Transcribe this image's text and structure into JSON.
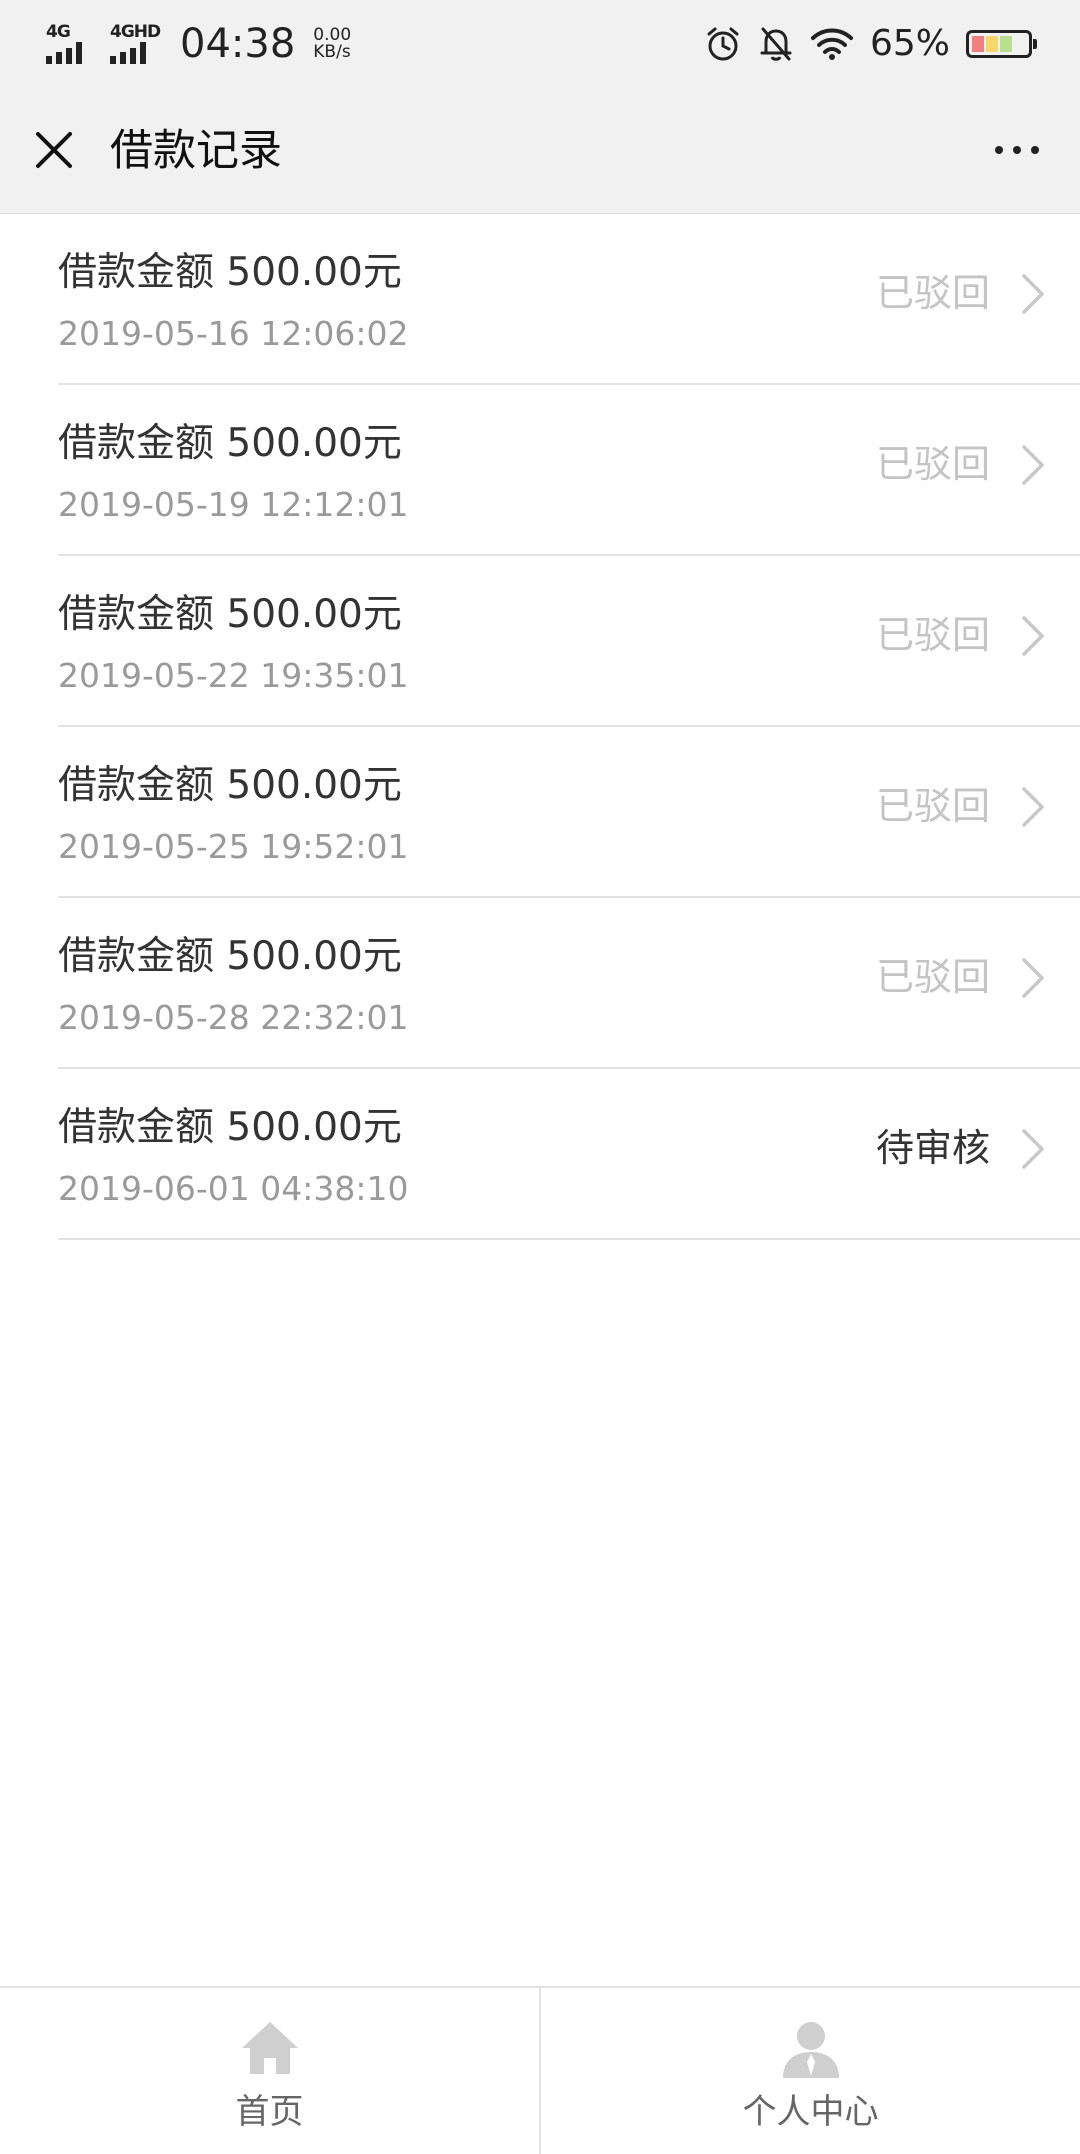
{
  "status_bar": {
    "network_1": "4G",
    "network_2": "4GHD",
    "time": "04:38",
    "speed_value": "0.00",
    "speed_unit": "KB/s",
    "battery_percent": "65%",
    "icons": [
      "alarm-icon",
      "bell-off-icon",
      "wifi-icon",
      "battery-icon"
    ]
  },
  "nav": {
    "title": "借款记录",
    "close_icon": "close-icon",
    "more_icon": "more-icon"
  },
  "colors": {
    "status_rejected": "#c4c4c4",
    "status_pending": "#333333",
    "date_gray": "#9a9a9a",
    "bar_bg": "#f1f1f1",
    "tab_icon_gray": "#cfcfcf"
  },
  "loans": [
    {
      "title": "借款金额 500.00元",
      "date": "2019-05-16 12:06:02",
      "status": "已驳回",
      "state": "rejected"
    },
    {
      "title": "借款金额 500.00元",
      "date": "2019-05-19 12:12:01",
      "status": "已驳回",
      "state": "rejected"
    },
    {
      "title": "借款金额 500.00元",
      "date": "2019-05-22 19:35:01",
      "status": "已驳回",
      "state": "rejected"
    },
    {
      "title": "借款金额 500.00元",
      "date": "2019-05-25 19:52:01",
      "status": "已驳回",
      "state": "rejected"
    },
    {
      "title": "借款金额 500.00元",
      "date": "2019-05-28 22:32:01",
      "status": "已驳回",
      "state": "rejected"
    },
    {
      "title": "借款金额 500.00元",
      "date": "2019-06-01 04:38:10",
      "status": "待审核",
      "state": "pending"
    }
  ],
  "tabs": [
    {
      "label": "首页",
      "icon": "home-icon"
    },
    {
      "label": "个人中心",
      "icon": "user-icon"
    }
  ]
}
